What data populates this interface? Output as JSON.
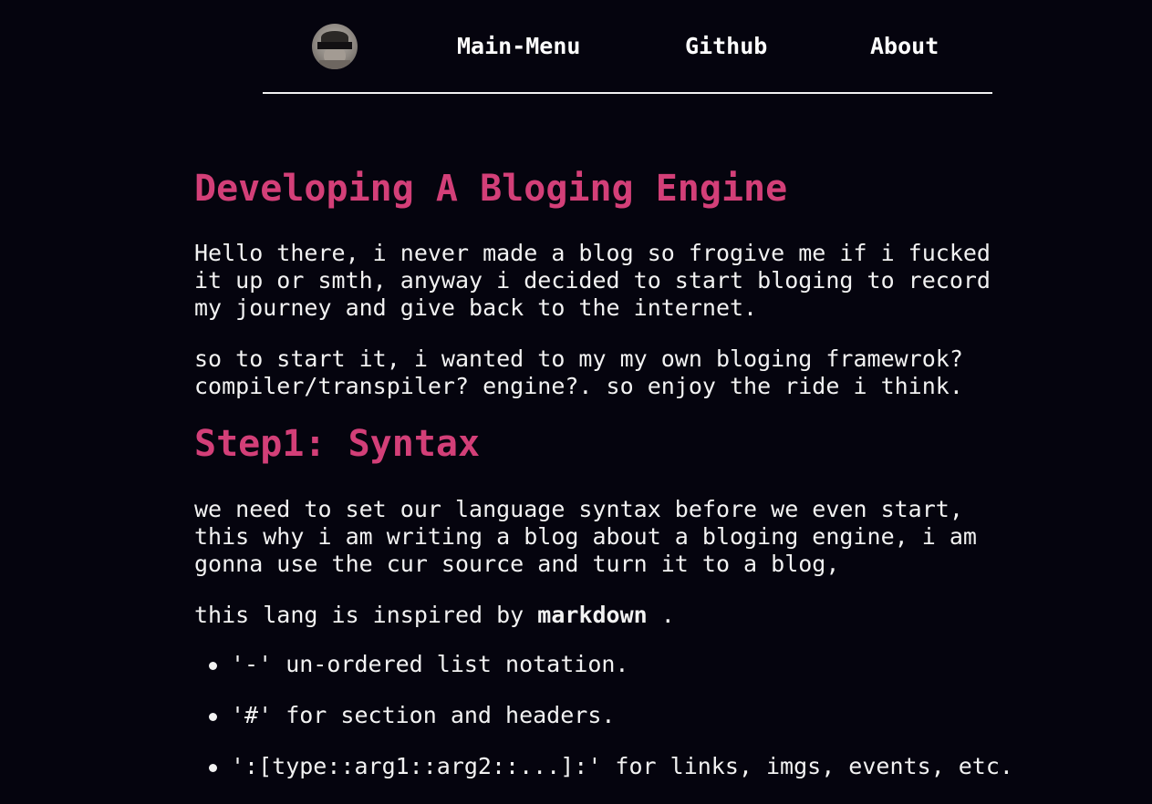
{
  "nav": {
    "links": [
      {
        "label": "Main-Menu"
      },
      {
        "label": "Github"
      },
      {
        "label": "About"
      }
    ]
  },
  "post": {
    "title": "Developing A Bloging Engine",
    "intro_paragraphs": [
      "Hello there, i never made a blog so frogive me if i fucked\nit up or smth, anyway i decided to start bloging to record\nmy journey and give back to the internet.",
      "so to start it, i wanted to my my own bloging framewrok?\ncompiler/transpiler? engine?. so enjoy the ride i think."
    ],
    "section1": {
      "heading": "Step1: Syntax",
      "paragraph": "we need to set our language syntax before we even start,\nthis why i am writing a blog about a bloging engine, i am\ngonna use the cur source and turn it to a blog,",
      "inspired_prefix": "this lang is inspired by ",
      "inspired_bold": "markdown",
      "inspired_suffix": " .",
      "list": [
        {
          "text": "'-' un-ordered list notation."
        },
        {
          "text": "'#' for section and headers."
        },
        {
          "text": "':[type::arg1::arg2::...]:' for links, imgs, events, etc."
        }
      ]
    }
  },
  "colors": {
    "background": "#05040e",
    "heading": "#d33f78",
    "text": "#f2f2f2"
  }
}
